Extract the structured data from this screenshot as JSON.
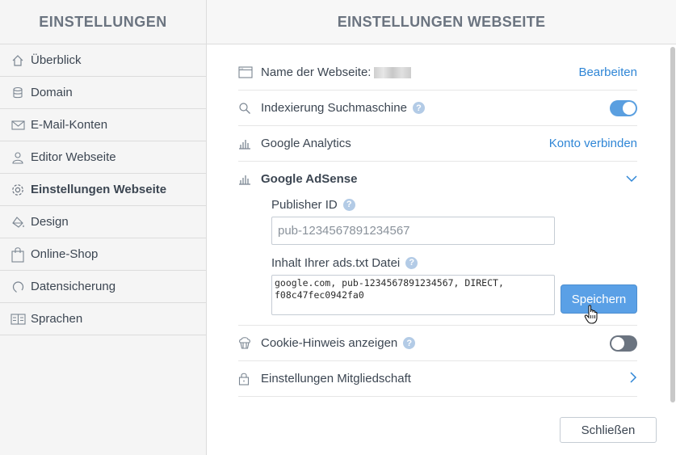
{
  "sidebar": {
    "title": "EINSTELLUNGEN",
    "items": [
      {
        "label": "Überblick",
        "icon": "home-icon"
      },
      {
        "label": "Domain",
        "icon": "database-icon"
      },
      {
        "label": "E-Mail-Konten",
        "icon": "mail-icon"
      },
      {
        "label": "Editor Webseite",
        "icon": "user-icon"
      },
      {
        "label": "Einstellungen Webseite",
        "icon": "gear-icon",
        "active": true
      },
      {
        "label": "Design",
        "icon": "paint-bucket-icon"
      },
      {
        "label": "Online-Shop",
        "icon": "shopping-bag-icon"
      },
      {
        "label": "Datensicherung",
        "icon": "backup-icon"
      },
      {
        "label": "Sprachen",
        "icon": "languages-icon"
      }
    ]
  },
  "main": {
    "title": "EINSTELLUNGEN WEBSEITE",
    "site_name": {
      "label": "Name der Webseite:",
      "action": "Bearbeiten"
    },
    "indexing": {
      "label": "Indexierung Suchmaschine",
      "help": "?",
      "enabled": true
    },
    "analytics": {
      "label": "Google Analytics",
      "action": "Konto verbinden"
    },
    "adsense": {
      "label": "Google AdSense",
      "publisher_label": "Publisher ID",
      "publisher_placeholder": "pub-1234567891234567",
      "adstxt_label": "Inhalt Ihrer ads.txt Datei",
      "adstxt_value": "google.com, pub-1234567891234567, DIRECT,\nf08c47fec0942fa0",
      "save": "Speichern",
      "help": "?"
    },
    "cookie": {
      "label": "Cookie-Hinweis anzeigen",
      "help": "?",
      "enabled": false
    },
    "membership": {
      "label": "Einstellungen Mitgliedschaft"
    },
    "close": "Schließen"
  },
  "colors": {
    "accent": "#2f86d6",
    "toggle_on": "#5a9fe0",
    "button": "#5aa0e6"
  }
}
